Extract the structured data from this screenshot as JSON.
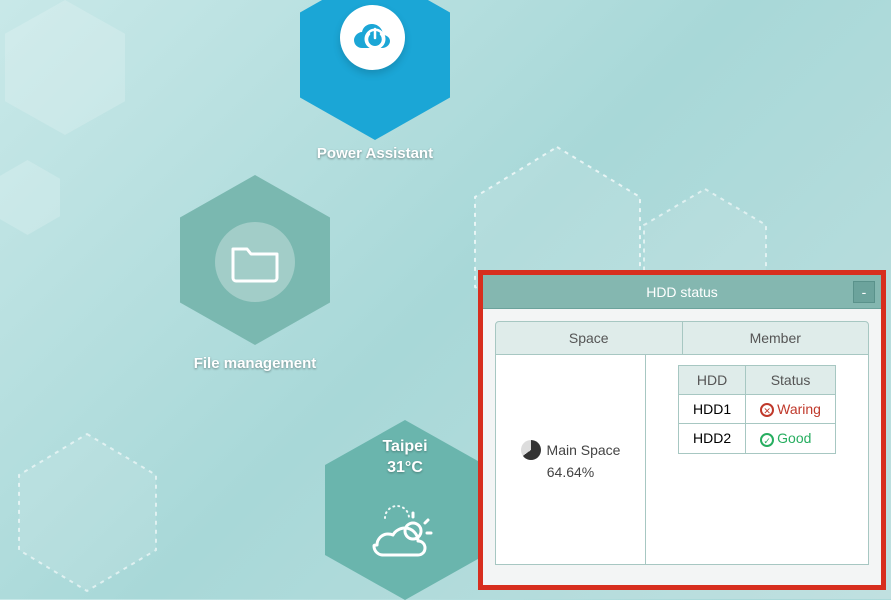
{
  "apps": {
    "power_assistant": {
      "label": "Power Assistant"
    },
    "file_management": {
      "label": "File management"
    }
  },
  "weather": {
    "city": "Taipei",
    "temp": "31°C"
  },
  "widget": {
    "title": "HDD status",
    "close_label": "-",
    "tabs": {
      "space": "Space",
      "member": "Member"
    },
    "space": {
      "name": "Main Space",
      "usage_percent": "64.64%"
    },
    "member_table": {
      "col_hdd": "HDD",
      "col_status": "Status",
      "rows": [
        {
          "hdd": "HDD1",
          "status": "Waring",
          "status_kind": "warning"
        },
        {
          "hdd": "HDD2",
          "status": "Good",
          "status_kind": "good"
        }
      ]
    }
  }
}
